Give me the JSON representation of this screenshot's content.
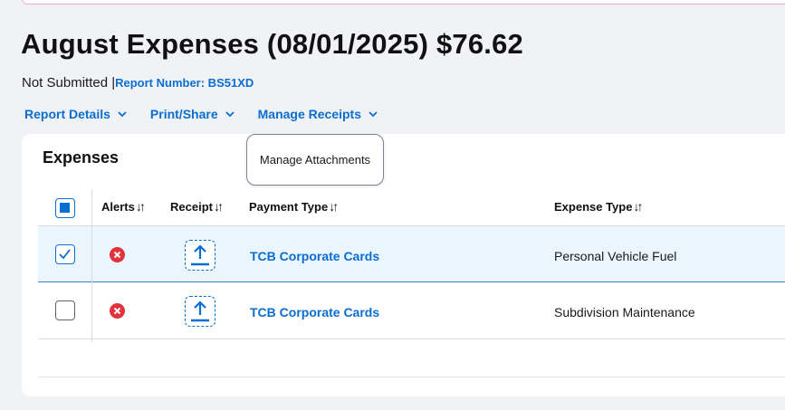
{
  "report": {
    "title": "August Expenses (08/01/2025) $76.62",
    "status": "Not Submitted",
    "separator": "|",
    "report_number_label": "Report Number: BS51XD"
  },
  "nav": [
    {
      "label": "Report Details",
      "icon": "chevron-down-icon"
    },
    {
      "label": "Print/Share",
      "icon": "chevron-down-icon"
    },
    {
      "label": "Manage Receipts",
      "icon": "chevron-down-icon"
    }
  ],
  "popover": {
    "label": "Manage Attachments"
  },
  "expenses": {
    "title": "Expenses",
    "columns": [
      "Alerts",
      "Receipt",
      "Payment Type",
      "Expense Type"
    ],
    "sort_glyph": "↓↑",
    "rows": [
      {
        "checked": true,
        "alert_icon": "error-icon",
        "receipt_icon": "upload-icon",
        "payment_type": "TCB Corporate Cards",
        "expense_type": "Personal Vehicle Fuel"
      },
      {
        "checked": false,
        "alert_icon": "error-icon",
        "receipt_icon": "upload-icon",
        "payment_type": "TCB Corporate Cards",
        "expense_type": "Subdivision Maintenance"
      }
    ]
  },
  "colors": {
    "accent": "#0a6ed1",
    "error": "#e0343a",
    "selected_row": "#eaf5fd"
  }
}
